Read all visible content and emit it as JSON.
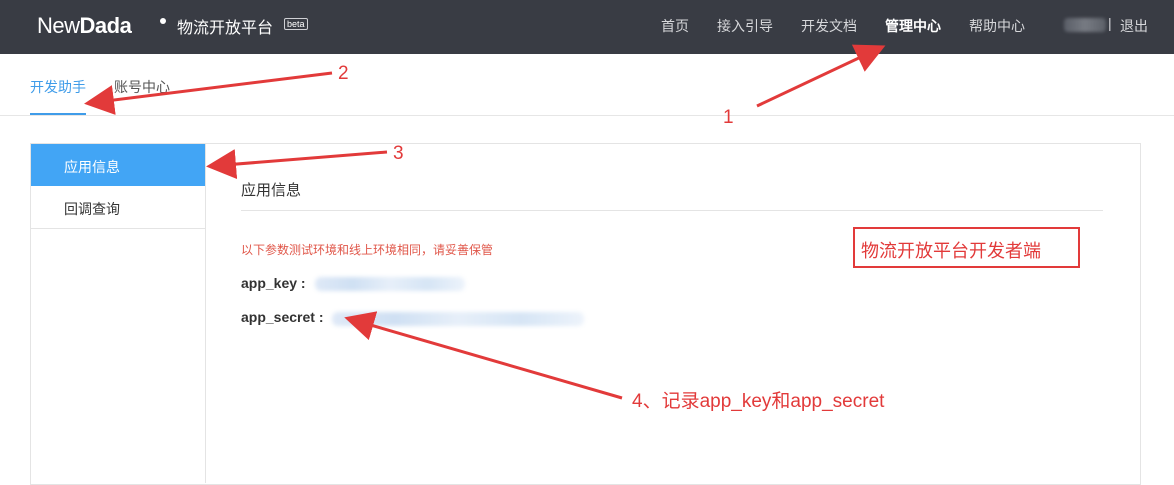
{
  "header": {
    "logo_thin": "New",
    "logo_bold": "Dada",
    "platform_name": "物流开放平台",
    "beta_badge": "beta",
    "nav": [
      "首页",
      "接入引导",
      "开发文档",
      "管理中心",
      "帮助中心"
    ],
    "active_nav": "管理中心",
    "separator": "|",
    "logout": "退出"
  },
  "tabs": [
    "开发助手",
    "账号中心"
  ],
  "sidebar": {
    "items": [
      "应用信息",
      "回调查询"
    ]
  },
  "content": {
    "title": "应用信息",
    "notice": "以下参数测试环境和线上环境相同，请妥善保管",
    "fields": [
      {
        "label": "app_key :"
      },
      {
        "label": "app_secret :"
      }
    ]
  },
  "annotations": {
    "box_text": "物流开放平台开发者端",
    "numbers": [
      "1",
      "2",
      "3"
    ],
    "step4": "4、记录app_key和app_secret",
    "color": "#e23a3a"
  },
  "colors": {
    "topbar": "#393c44",
    "accent": "#3f9ce9",
    "menu_active": "#42a5f5",
    "notice": "#e0574a"
  }
}
